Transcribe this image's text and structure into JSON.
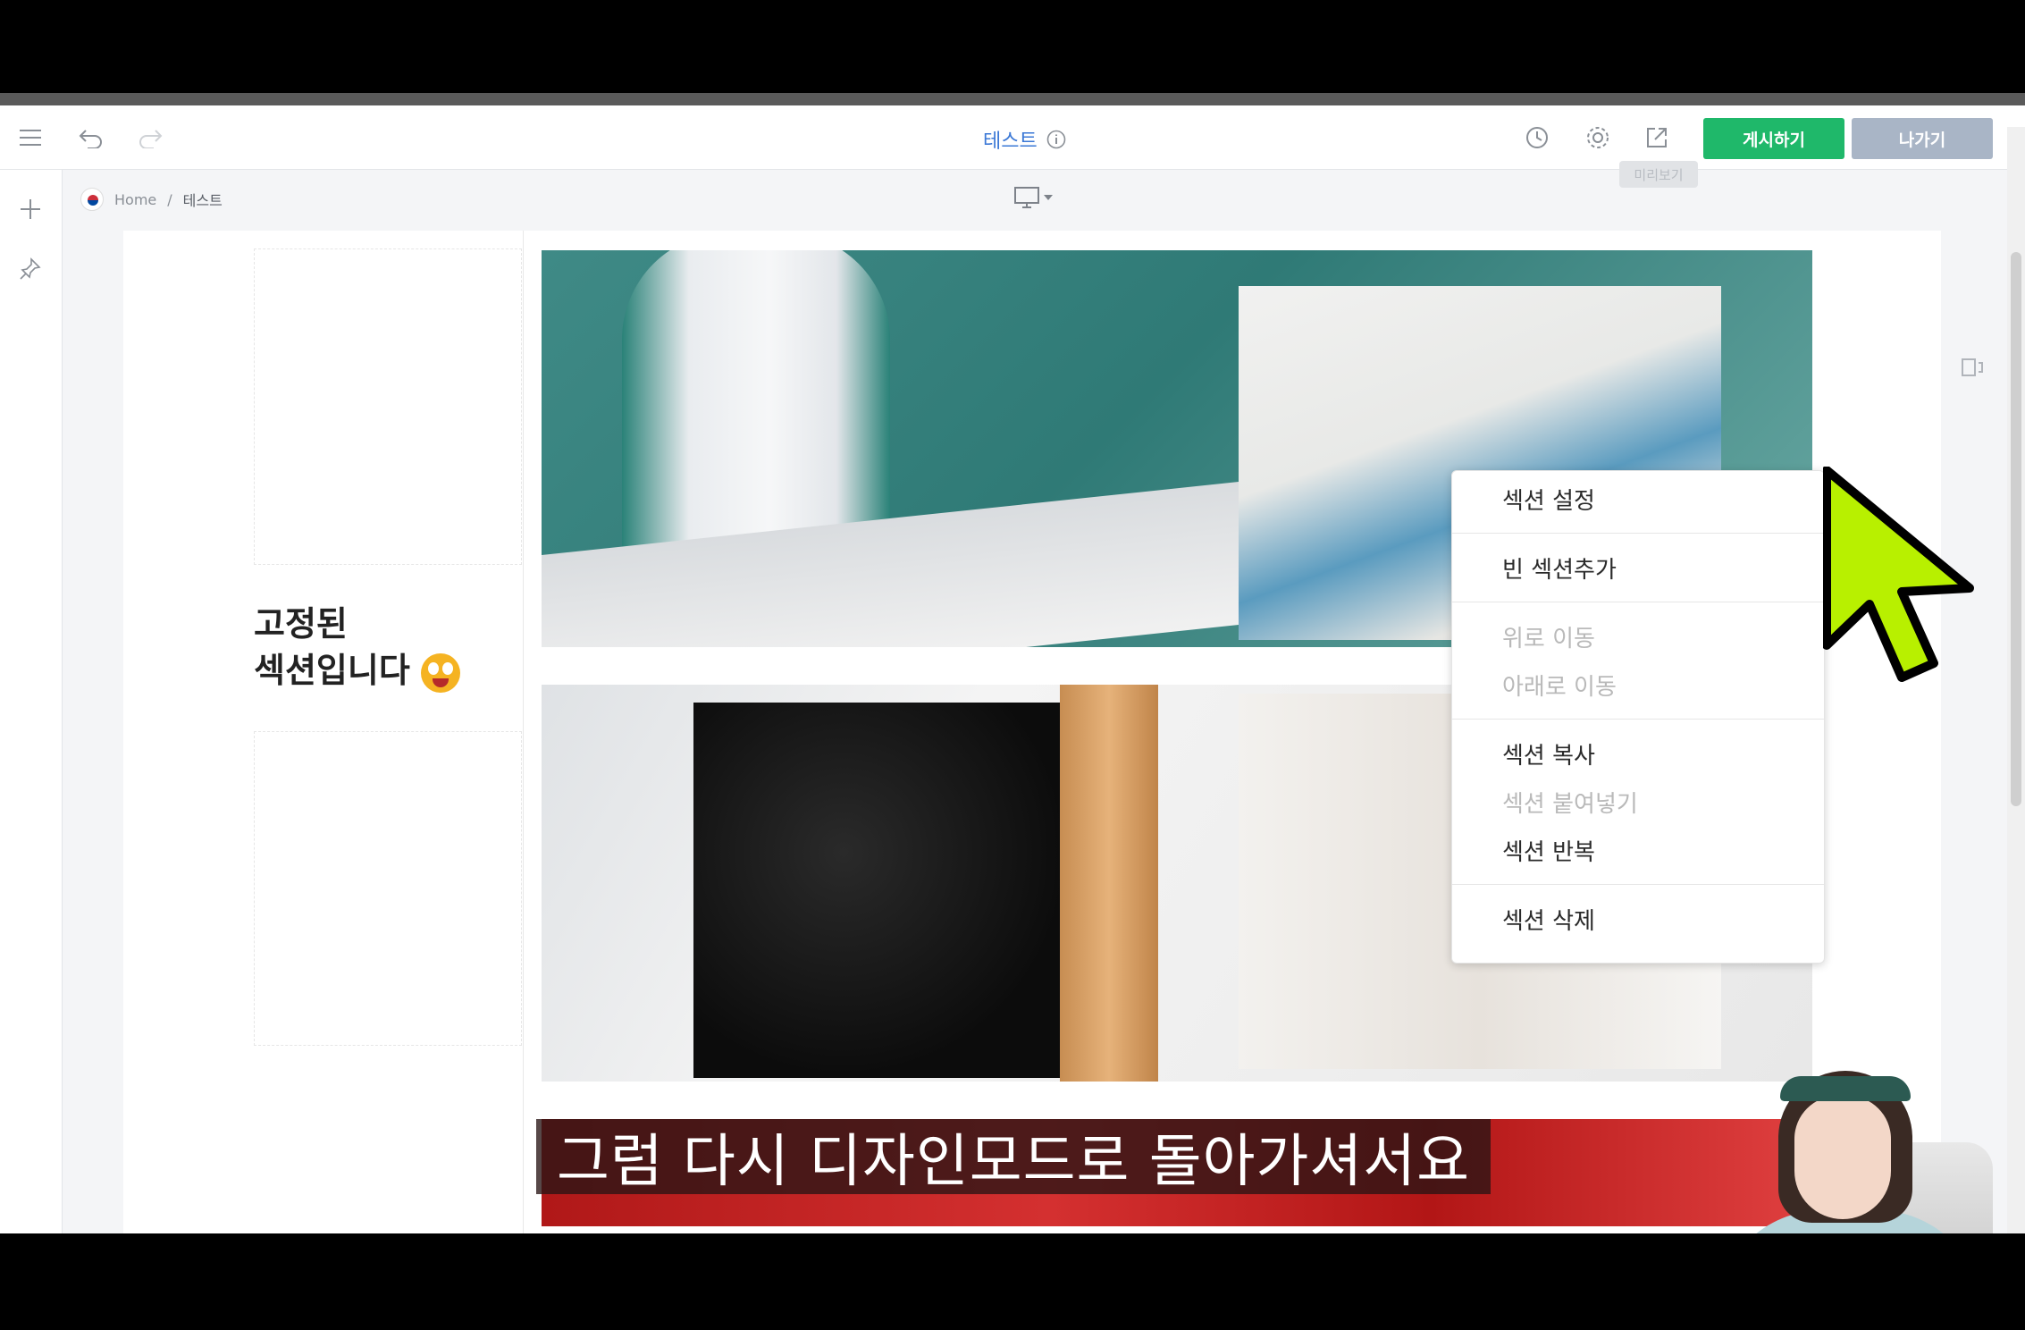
{
  "toolbar": {
    "doc_title": "테스트",
    "publish_label": "게시하기",
    "exit_label": "나가기",
    "tooltip_label": "미리보기"
  },
  "breadcrumb": {
    "home": "Home",
    "separator": "/",
    "current": "테스트"
  },
  "fixed_section": {
    "line1": "고정된",
    "line2": "섹션입니다"
  },
  "context_menu": {
    "section_settings": "섹션 설정",
    "add_empty_section": "빈 섹션추가",
    "move_up": "위로 이동",
    "move_down": "아래로 이동",
    "copy_section": "섹션 복사",
    "paste_section": "섹션 붙여넣기",
    "repeat_section": "섹션 반복",
    "delete_section": "섹션 삭제"
  },
  "subtitle": "그럼 다시 디자인모드로 돌아가셔서요",
  "colors": {
    "publish": "#1fb86a",
    "exit": "#a9b5c6",
    "title": "#3b78d6",
    "cursor": "#b8f000"
  },
  "icons": [
    "menu-icon",
    "undo-icon",
    "redo-icon",
    "info-icon",
    "history-icon",
    "gear-icon",
    "external-link-icon",
    "plus-icon",
    "pin-icon",
    "desktop-icon",
    "chevron-down-icon",
    "collapse-icon"
  ]
}
